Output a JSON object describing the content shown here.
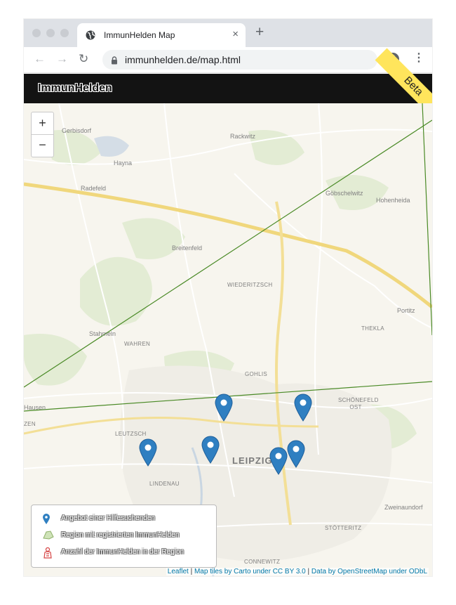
{
  "browser": {
    "tab_title": "ImmunHelden Map",
    "tab_close": "×",
    "new_tab": "+",
    "url": "immunhelden.de/map.html",
    "back": "←",
    "forward": "→",
    "reload": "↻",
    "bookmark": "☆",
    "menu": "⋮"
  },
  "app": {
    "brand": "ImmunHelden",
    "ribbon": "Beta"
  },
  "map": {
    "zoom_in": "+",
    "zoom_out": "−",
    "places": [
      "Gerbisdorf",
      "Rackwitz",
      "Hayna",
      "Radefeld",
      "Göbschelwitz",
      "Hohenheida",
      "Breitenfeld",
      "WIEDERITZSCH",
      "Portitz",
      "THEKLA",
      "Stahmeln",
      "WAHREN",
      "GOHLIS",
      "SCHÖNEFELD OST",
      "Hausen",
      "LEUTZSCH",
      "LEIPZIG",
      "LINDENAU",
      "Zweinaundorf",
      "STÖTTERITZ",
      "CONNEWITZ",
      "ZEN"
    ],
    "marker_color": "#2f7fc1",
    "line_color": "#4a8a26"
  },
  "legend": {
    "items": [
      {
        "icon": "marker-icon",
        "label": "Angebot einer Hilfesuchenden"
      },
      {
        "icon": "region-icon",
        "label": "Region mit registrierten ImmunHelden"
      },
      {
        "icon": "hero-count-icon",
        "label": "Anzahl der ImmunHelden in der Region"
      }
    ]
  },
  "attribution": {
    "leaflet": "Leaflet",
    "sep1": " | ",
    "tiles": "Map tiles by Carto under CC BY 3.0",
    "sep2": " | ",
    "data": "Data by OpenStreetMap under ODbL"
  }
}
